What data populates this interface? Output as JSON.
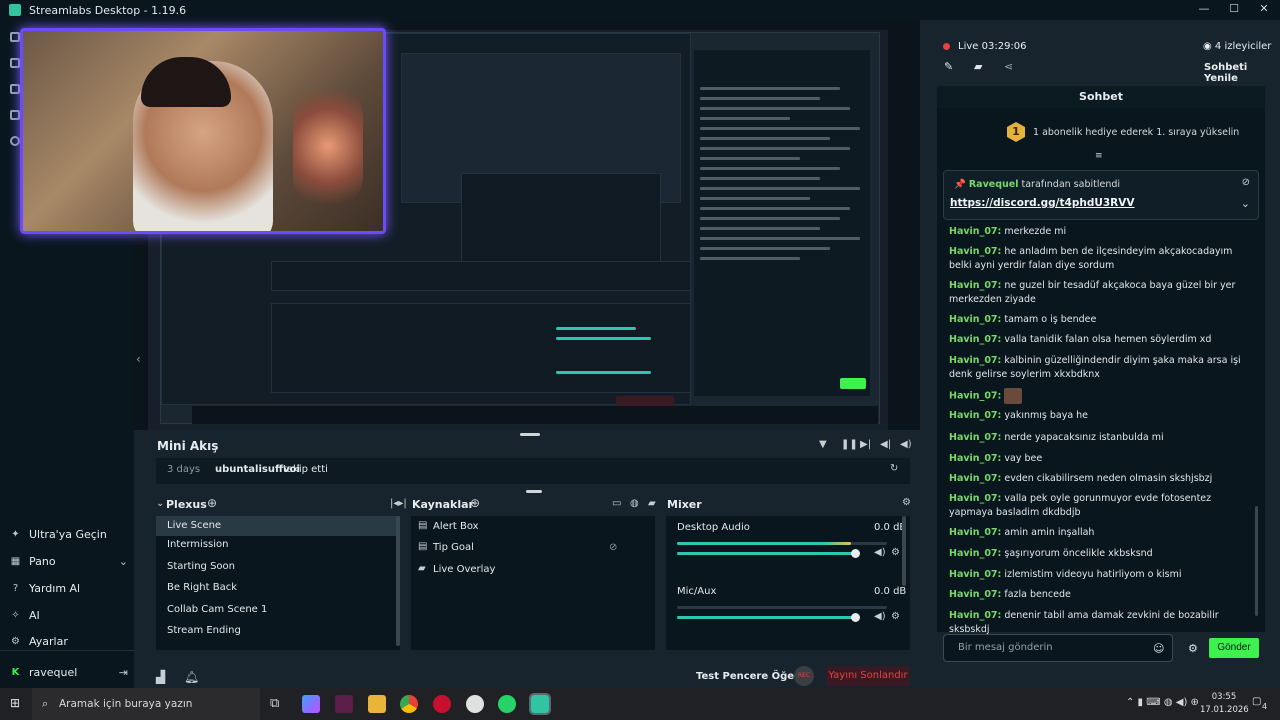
{
  "window": {
    "title": "Streamlabs Desktop - 1.19.6",
    "btn_min": "—",
    "btn_max": "☐",
    "btn_close": "✕"
  },
  "nav": {
    "items": [
      {
        "label": "Ultra'ya Geçin",
        "icon": "sparkle-icon"
      },
      {
        "label": "Pano",
        "icon": "dashboard-icon"
      },
      {
        "label": "Yardım Al",
        "icon": "help-icon"
      },
      {
        "label": "AI",
        "icon": "ai-icon"
      },
      {
        "label": "Ayarlar",
        "icon": "gear-icon"
      }
    ],
    "chevron": "⌄",
    "user": "ravequel",
    "logout": "⇥"
  },
  "stream": {
    "live": "Live",
    "time": "03:29:06",
    "viewers": "4 izleyiciler",
    "refresh": "Sohbeti Yenile"
  },
  "chat": {
    "title": "Sohbet",
    "gift_rank": "1",
    "gift_text": "1 abonelik hediye ederek 1. sıraya yükselin",
    "pinned_by_user": "Ravequel",
    "pinned_by_suffix": "tarafından sabitlendi",
    "pinned_link": "https://discord.gg/t4phdU3RVV",
    "messages": [
      {
        "user": "Havin_07:",
        "text": "merkezde mi"
      },
      {
        "user": "Havin_07:",
        "text": "he anladım ben de ilçesindeyim akçakocadayım belki ayni yerdir falan diye sordum"
      },
      {
        "user": "Havin_07:",
        "text": "ne guzel bir tesadüf akçakoca baya güzel bir yer merkezden ziyade"
      },
      {
        "user": "Havin_07:",
        "text": "tamam o iş bendee"
      },
      {
        "user": "Havin_07:",
        "text": "valla tanidik falan olsa hemen söylerdim xd"
      },
      {
        "user": "Havin_07:",
        "text": "kalbinin güzelliğindendir diyim şaka maka arsa işi denk gelirse soylerim xkxbdknx"
      },
      {
        "user": "Havin_07:",
        "text": ""
      },
      {
        "user": "Havin_07:",
        "text": "yakınmış baya he"
      },
      {
        "user": "Havin_07:",
        "text": "nerde yapacaksınız istanbulda mi"
      },
      {
        "user": "Havin_07:",
        "text": "vay bee"
      },
      {
        "user": "Havin_07:",
        "text": "evden cikabilirsem neden olmasin skshjsbzj"
      },
      {
        "user": "Havin_07:",
        "text": "valla pek oyle gorunmuyor evde fotosentez yapmaya basladim dkdbdjb"
      },
      {
        "user": "Havin_07:",
        "text": "amin amin inşallah"
      },
      {
        "user": "Havin_07:",
        "text": "şaşırıyorum öncelikle xkbsksnd"
      },
      {
        "user": "Havin_07:",
        "text": "izlemistim videoyu hatirliyom o kismi"
      },
      {
        "user": "Havin_07:",
        "text": "fazla bencede"
      },
      {
        "user": "Havin_07:",
        "text": "denenir tabil ama damak zevkini de bozabilir sksbskdj"
      }
    ],
    "input_placeholder": "Bir mesaj gönderin",
    "send": "Gönder"
  },
  "mini_feed": {
    "title": "Mini Akış",
    "time": "3 days",
    "user": "ubuntalisuffvoi",
    "action": "takip etti"
  },
  "scenes": {
    "title": "Plexus",
    "items": [
      "Live Scene",
      "Intermission",
      "Starting Soon",
      "Be Right Back",
      "Collab Cam Scene 1",
      "Stream Ending"
    ]
  },
  "sources": {
    "title": "Kaynaklar",
    "items": [
      "Alert Box",
      "Tip Goal",
      "Live Overlay"
    ]
  },
  "mixer": {
    "title": "Mixer",
    "channels": [
      {
        "name": "Desktop Audio",
        "db": "0.0 dB",
        "level": 0.83
      },
      {
        "name": "Mic/Aux",
        "db": "0.0 dB",
        "level": 0.0
      }
    ]
  },
  "footer": {
    "test_widgets": "Test Pencere Öğeleri",
    "end_stream": "Yayını Sonlandır",
    "rec": "REC"
  },
  "taskbar": {
    "search": "Aramak için buraya yazın",
    "time": "03:55",
    "date": "17.01.2026",
    "notif": "4"
  }
}
